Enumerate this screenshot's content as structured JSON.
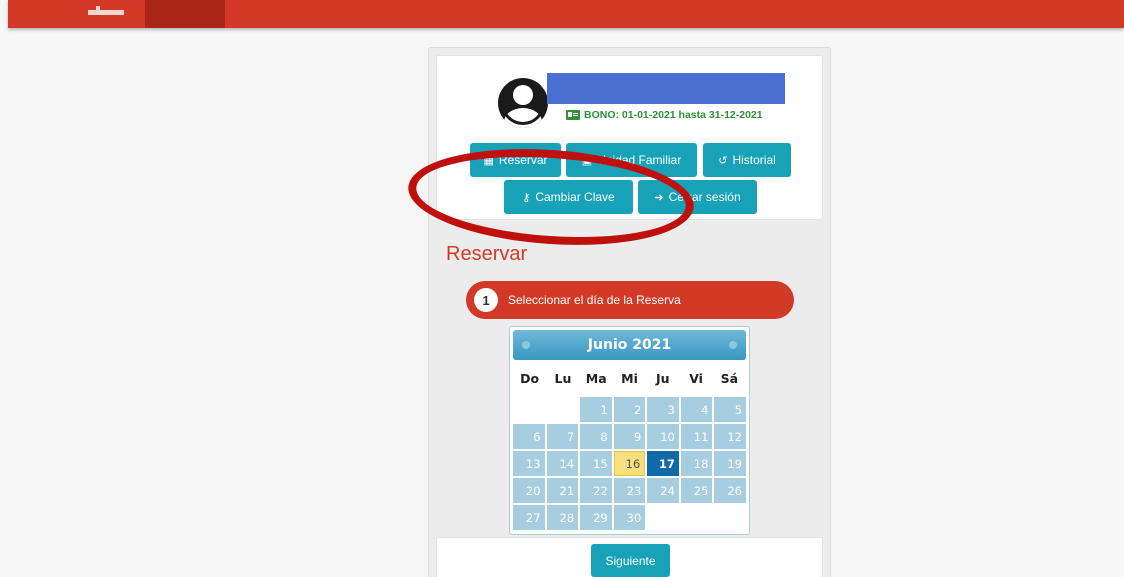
{
  "user": {
    "bono_label": "BONO: 01-01-2021 hasta 31-12-2021"
  },
  "actions": {
    "reservar": "Reservar",
    "unidad_familiar": "Unidad Familiar",
    "historial": "Historial",
    "cambiar_clave": "Cambiar Clave",
    "cerrar_sesion": "Cerrar sesión"
  },
  "section": {
    "title": "Reservar"
  },
  "step": {
    "number": "1",
    "label": "Seleccionar el día de la Reserva"
  },
  "calendar": {
    "month_label": "Junio 2021",
    "weekdays": [
      "Do",
      "Lu",
      "Ma",
      "Mi",
      "Ju",
      "Vi",
      "Sá"
    ],
    "leading_blanks": 2,
    "days": [
      "1",
      "2",
      "3",
      "4",
      "5",
      "6",
      "7",
      "8",
      "9",
      "10",
      "11",
      "12",
      "13",
      "14",
      "15",
      "16",
      "17",
      "18",
      "19",
      "20",
      "21",
      "22",
      "23",
      "24",
      "25",
      "26",
      "27",
      "28",
      "29",
      "30"
    ],
    "highlighted_day": "16",
    "selected_day": "17"
  },
  "footer": {
    "next_label": "Siguiente"
  },
  "colors": {
    "brand": "#d23a27",
    "button": "#17a2b8",
    "annotation": "#c0100e"
  }
}
